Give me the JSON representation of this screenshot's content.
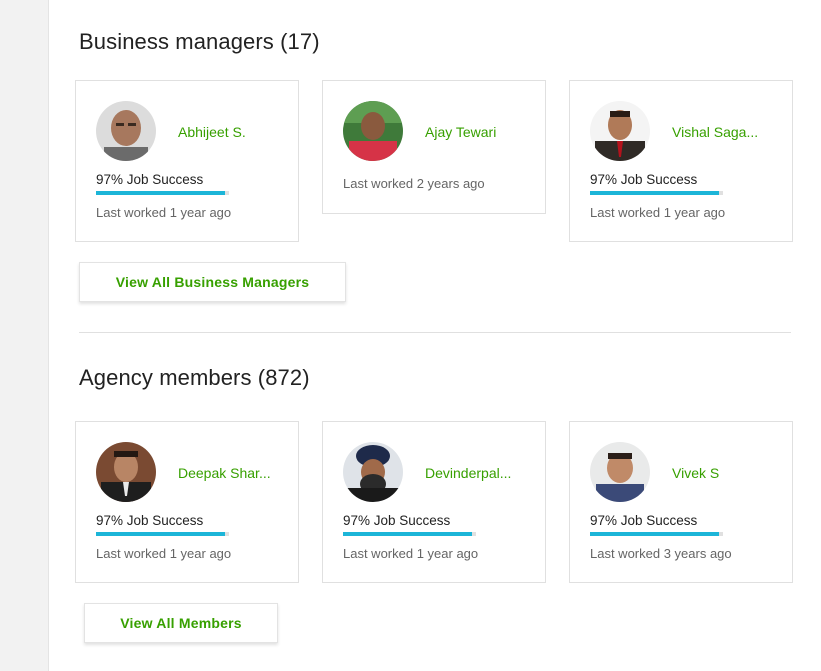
{
  "business_managers": {
    "title": "Business managers (17)",
    "button_label": "View All Business Managers",
    "cards": [
      {
        "name": "Abhijeet S.",
        "job_success": "97% Job Success",
        "job_success_value": 0.97,
        "last_worked": "Last worked 1 year ago"
      },
      {
        "name": "Ajay Tewari",
        "last_worked": "Last worked 2 years ago"
      },
      {
        "name": "Vishal Saga...",
        "job_success": "97% Job Success",
        "job_success_value": 0.97,
        "last_worked": "Last worked 1 year ago"
      }
    ]
  },
  "agency_members": {
    "title": "Agency members (872)",
    "button_label": "View All Members",
    "cards": [
      {
        "name": "Deepak Shar...",
        "job_success": "97% Job Success",
        "job_success_value": 0.97,
        "last_worked": "Last worked 1 year ago"
      },
      {
        "name": "Devinderpal...",
        "job_success": "97% Job Success",
        "job_success_value": 0.97,
        "last_worked": "Last worked 1 year ago"
      },
      {
        "name": "Vivek S",
        "job_success": "97% Job Success",
        "job_success_value": 0.97,
        "last_worked": "Last worked 3 years ago"
      }
    ]
  },
  "colors": {
    "accent_green": "#37a000",
    "progress_blue": "#1cb5d8"
  }
}
